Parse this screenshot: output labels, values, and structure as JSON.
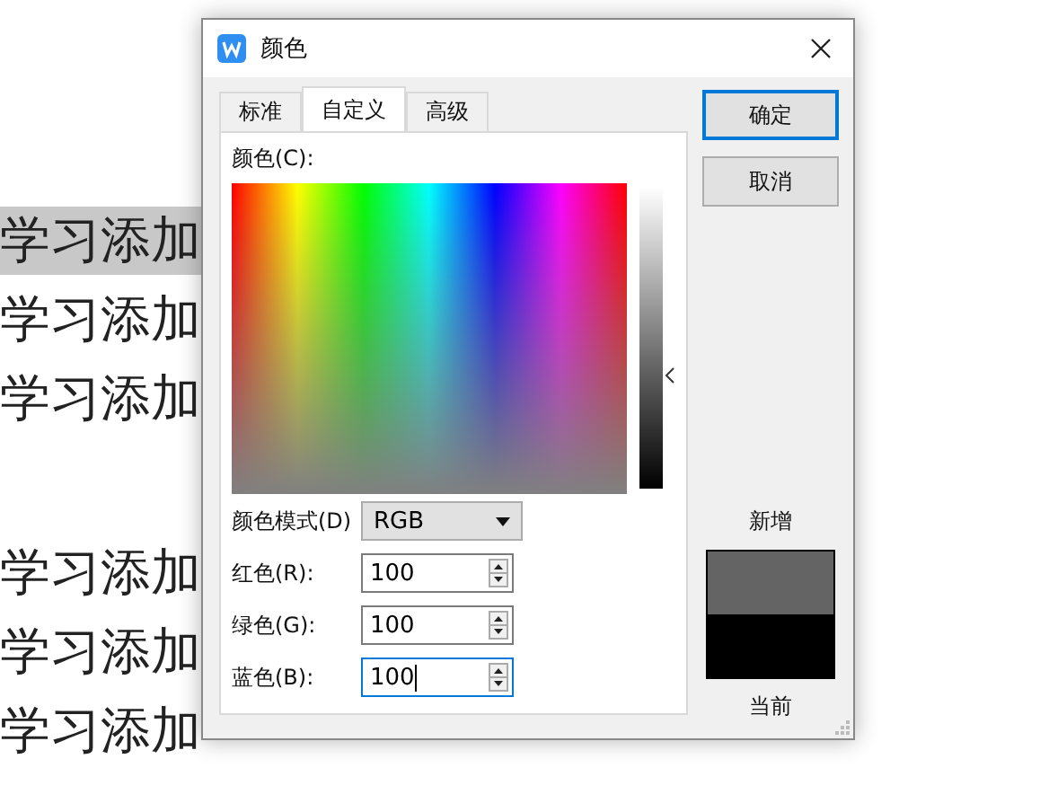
{
  "document": {
    "lines": [
      {
        "text": "学习添加",
        "highlighted": true
      },
      {
        "text": "学习添加",
        "highlighted": false
      },
      {
        "text": "学习添加",
        "highlighted": false
      },
      {
        "text": "学习添加",
        "highlighted": false
      },
      {
        "text": "学习添加",
        "highlighted": false
      },
      {
        "text": "学习添加",
        "highlighted": false
      }
    ]
  },
  "dialog": {
    "title": "颜色",
    "tabs": [
      {
        "label": "标准",
        "selected": false
      },
      {
        "label": "自定义",
        "selected": true
      },
      {
        "label": "高级",
        "selected": false
      }
    ],
    "color_label": "颜色(C):",
    "luminance": {
      "level": 0.39
    },
    "mode": {
      "label": "颜色模式(D)",
      "value": "RGB"
    },
    "channels": [
      {
        "label": "红色(R):",
        "value": "100",
        "focused": false
      },
      {
        "label": "绿色(G):",
        "value": "100",
        "focused": false
      },
      {
        "label": "蓝色(B):",
        "value": "100",
        "focused": true
      }
    ],
    "buttons": [
      {
        "label": "确定",
        "default": true
      },
      {
        "label": "取消",
        "default": false
      }
    ],
    "preview": {
      "new_label": "新增",
      "swatches": [
        {
          "color": "#646464"
        },
        {
          "color": "#000000"
        }
      ],
      "current_label": "当前"
    }
  }
}
